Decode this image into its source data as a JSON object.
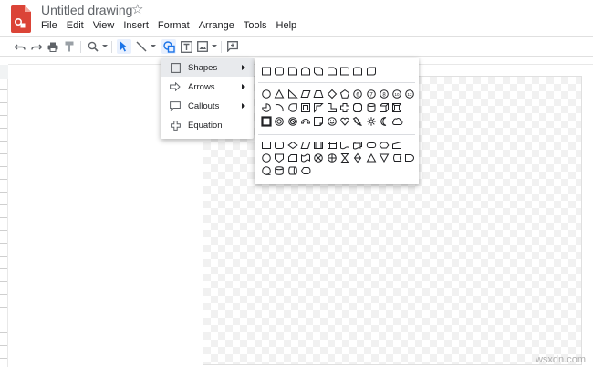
{
  "app": {
    "title": "Untitled drawing",
    "brand_color": "#db4437",
    "accent_color": "#1a73e8"
  },
  "menubar": [
    {
      "label": "File"
    },
    {
      "label": "Edit"
    },
    {
      "label": "View"
    },
    {
      "label": "Insert"
    },
    {
      "label": "Format"
    },
    {
      "label": "Arrange"
    },
    {
      "label": "Tools"
    },
    {
      "label": "Help"
    }
  ],
  "toolbar": {
    "buttons": [
      {
        "name": "undo-icon"
      },
      {
        "name": "redo-icon"
      },
      {
        "name": "print-icon"
      },
      {
        "name": "paint-format-icon"
      },
      {
        "name": "zoom-icon"
      },
      {
        "name": "select-icon"
      },
      {
        "name": "line-icon"
      },
      {
        "name": "shape-icon"
      },
      {
        "name": "text-box-icon"
      },
      {
        "name": "image-icon"
      },
      {
        "name": "comment-icon"
      }
    ]
  },
  "shape_menu": {
    "items": [
      {
        "label": "Shapes",
        "icon": "square-icon"
      },
      {
        "label": "Arrows",
        "icon": "arrow-icon"
      },
      {
        "label": "Callouts",
        "icon": "callout-icon"
      },
      {
        "label": "Equation",
        "icon": "plus-icon"
      }
    ]
  },
  "shapes_submenu": {
    "rows": [
      [
        "rect",
        "round-rect",
        "snip-rect",
        "snip2-rect",
        "snip-diag-rect",
        "snip-round-rect",
        "round1-rect",
        "round2-rect",
        "round-diag-rect"
      ],
      [
        "oval",
        "triangle",
        "right-triangle",
        "parallelogram",
        "trapezoid",
        "diamond",
        "pentagon",
        "hexagon",
        "heptagon",
        "octagon",
        "decagon",
        "dodecagon"
      ],
      [
        "pie",
        "arc",
        "teardrop",
        "frame",
        "half-frame",
        "l-shape",
        "cross",
        "plaque",
        "can",
        "cube",
        "bevel"
      ],
      [
        "frame-square",
        "donut",
        "no-symbol",
        "block-arc",
        "folded-corner",
        "smiley",
        "heart",
        "lightning",
        "sun",
        "moon",
        "cloud"
      ],
      [
        "process",
        "alt-process",
        "decision",
        "data",
        "predefined",
        "internal-storage",
        "document",
        "multidoc",
        "terminator",
        "preparation",
        "manual-input"
      ],
      [
        "connector",
        "offpage",
        "card",
        "punched-tape",
        "summing",
        "or",
        "collate",
        "sort",
        "extract",
        "merge",
        "stored-data",
        "delay"
      ],
      [
        "sequential",
        "magnetic-disk",
        "direct-access",
        "display"
      ]
    ]
  },
  "watermark": "wsxdn.com"
}
